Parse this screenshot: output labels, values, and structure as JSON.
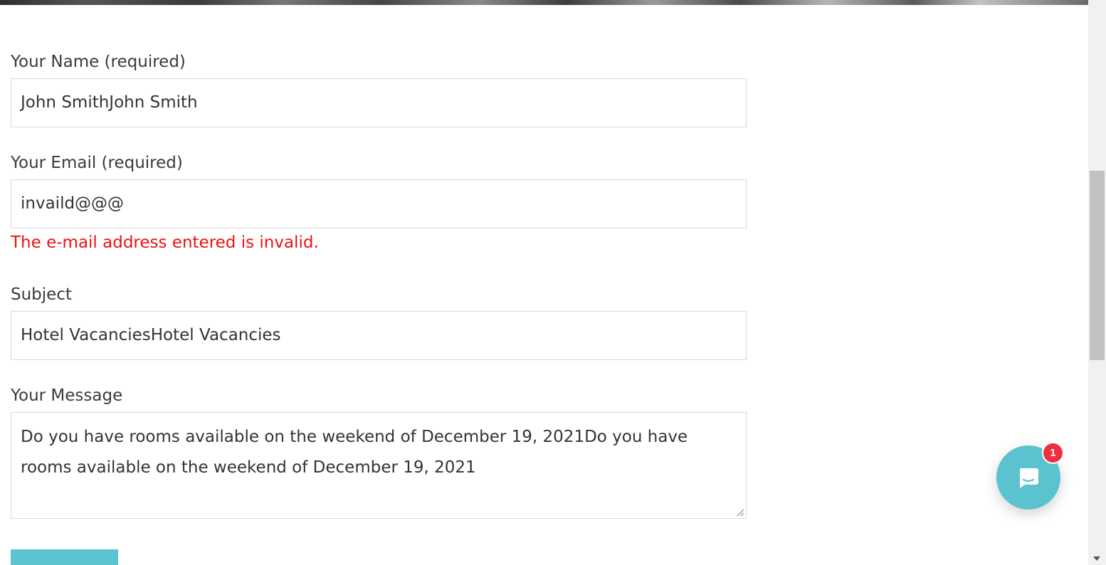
{
  "form": {
    "name": {
      "label": "Your Name (required)",
      "value": "John SmithJohn Smith"
    },
    "email": {
      "label": "Your Email (required)",
      "value": "invaild@@@",
      "error": "The e-mail address entered is invalid."
    },
    "subject": {
      "label": "Subject",
      "value": "Hotel VacanciesHotel Vacancies"
    },
    "message": {
      "label": "Your Message",
      "value": "Do you have rooms available on the weekend of  December 19, 2021Do you have rooms available on the weekend of  December 19, 2021"
    }
  },
  "chat": {
    "badge_count": "1",
    "icon": "chat-bubble-icon"
  },
  "colors": {
    "accent": "#5bc2cf",
    "error": "#ee1111",
    "badge": "#ef2f3f"
  }
}
